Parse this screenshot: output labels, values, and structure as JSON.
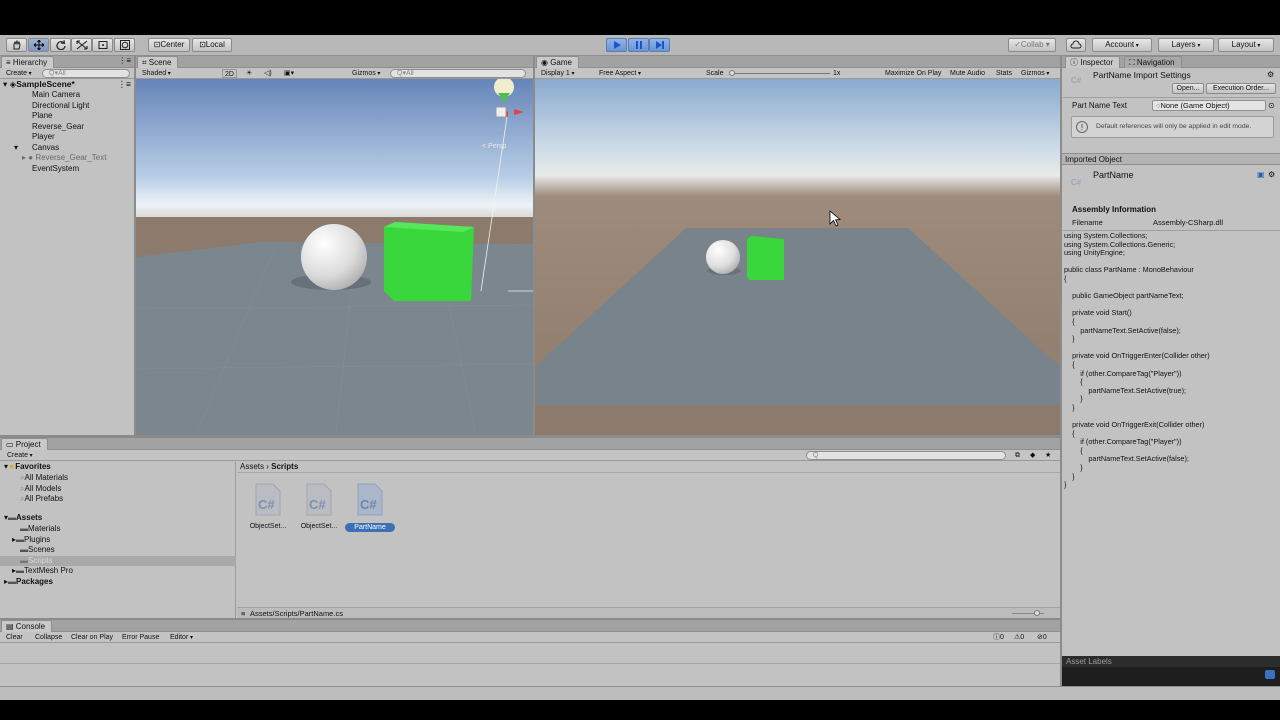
{
  "toolbar": {
    "pivot_center": "Center",
    "pivot_local": "Local",
    "collab": "Collab ▾",
    "account": "Account",
    "layers": "Layers",
    "layout": "Layout"
  },
  "hierarchy": {
    "tab": "Hierarchy",
    "create": "Create",
    "search_placeholder": "Q▾All",
    "scene_name": "SampleScene*",
    "items": [
      "Main Camera",
      "Directional Light",
      "Plane",
      "Reverse_Gear",
      "Player",
      "Canvas",
      "Reverse_Gear_Text",
      "EventSystem"
    ]
  },
  "scene": {
    "tab": "Scene",
    "shading": "Shaded",
    "mode_2d": "2D",
    "gizmos": "Gizmos",
    "search_placeholder": "Q▾All",
    "persp_label": "< Persp"
  },
  "game": {
    "tab": "Game",
    "display": "Display 1",
    "aspect": "Free Aspect",
    "scale_label": "Scale",
    "scale_value": "1x",
    "maximize": "Maximize On Play",
    "mute": "Mute Audio",
    "stats": "Stats",
    "gizmos": "Gizmos"
  },
  "inspector": {
    "tab_inspector": "Inspector",
    "tab_navigation": "Navigation",
    "title": "PartName Import Settings",
    "open_button": "Open...",
    "exec_order_button": "Execution Order...",
    "field_label": "Part Name Text",
    "field_value": "None (Game Object)",
    "info_message": "Default references will only be applied in edit mode.",
    "imported_object": "Imported Object",
    "object_name": "PartName",
    "assembly_header": "Assembly Information",
    "filename_label": "Filename",
    "filename_value": "Assembly-CSharp.dll",
    "code": "using System.Collections;\nusing System.Collections.Generic;\nusing UnityEngine;\n\npublic class PartName : MonoBehaviour\n{\n\n    public GameObject partNameText;\n\n    private void Start()\n    {\n        partNameText.SetActive(false);\n    }\n\n    private void OnTriggerEnter(Collider other)\n    {\n        if (other.CompareTag(\"Player\"))\n        {\n            partNameText.SetActive(true);\n        }\n    }\n\n    private void OnTriggerExit(Collider other)\n    {\n        if (other.CompareTag(\"Player\"))\n        {\n            partNameText.SetActive(false);\n        }\n    }\n}",
    "asset_labels": "Asset Labels"
  },
  "project": {
    "tab": "Project",
    "create": "Create",
    "favorites": "Favorites",
    "favorite_items": [
      "All Materials",
      "All Models",
      "All Prefabs"
    ],
    "assets": "Assets",
    "asset_folders": [
      "Materials",
      "Plugins",
      "Scenes",
      "Scripts",
      "TextMesh Pro"
    ],
    "packages": "Packages",
    "breadcrumb_root": "Assets",
    "breadcrumb_current": "Scripts",
    "files": [
      "ObjectSet...",
      "ObjectSet...",
      "PartName"
    ],
    "file_icon_text": "C#",
    "path": "Assets/Scripts/PartName.cs"
  },
  "console": {
    "tab": "Console",
    "clear": "Clear",
    "collapse": "Collapse",
    "clear_on_play": "Clear on Play",
    "error_pause": "Error Pause",
    "editor": "Editor",
    "count_log": "0",
    "count_warn": "0",
    "count_error": "0"
  },
  "colors": {
    "editor_bg": "#c2c2c2",
    "selection": "#3d6fb5",
    "cube_green": "#39d93a",
    "play_blue": "#4a86d8"
  }
}
